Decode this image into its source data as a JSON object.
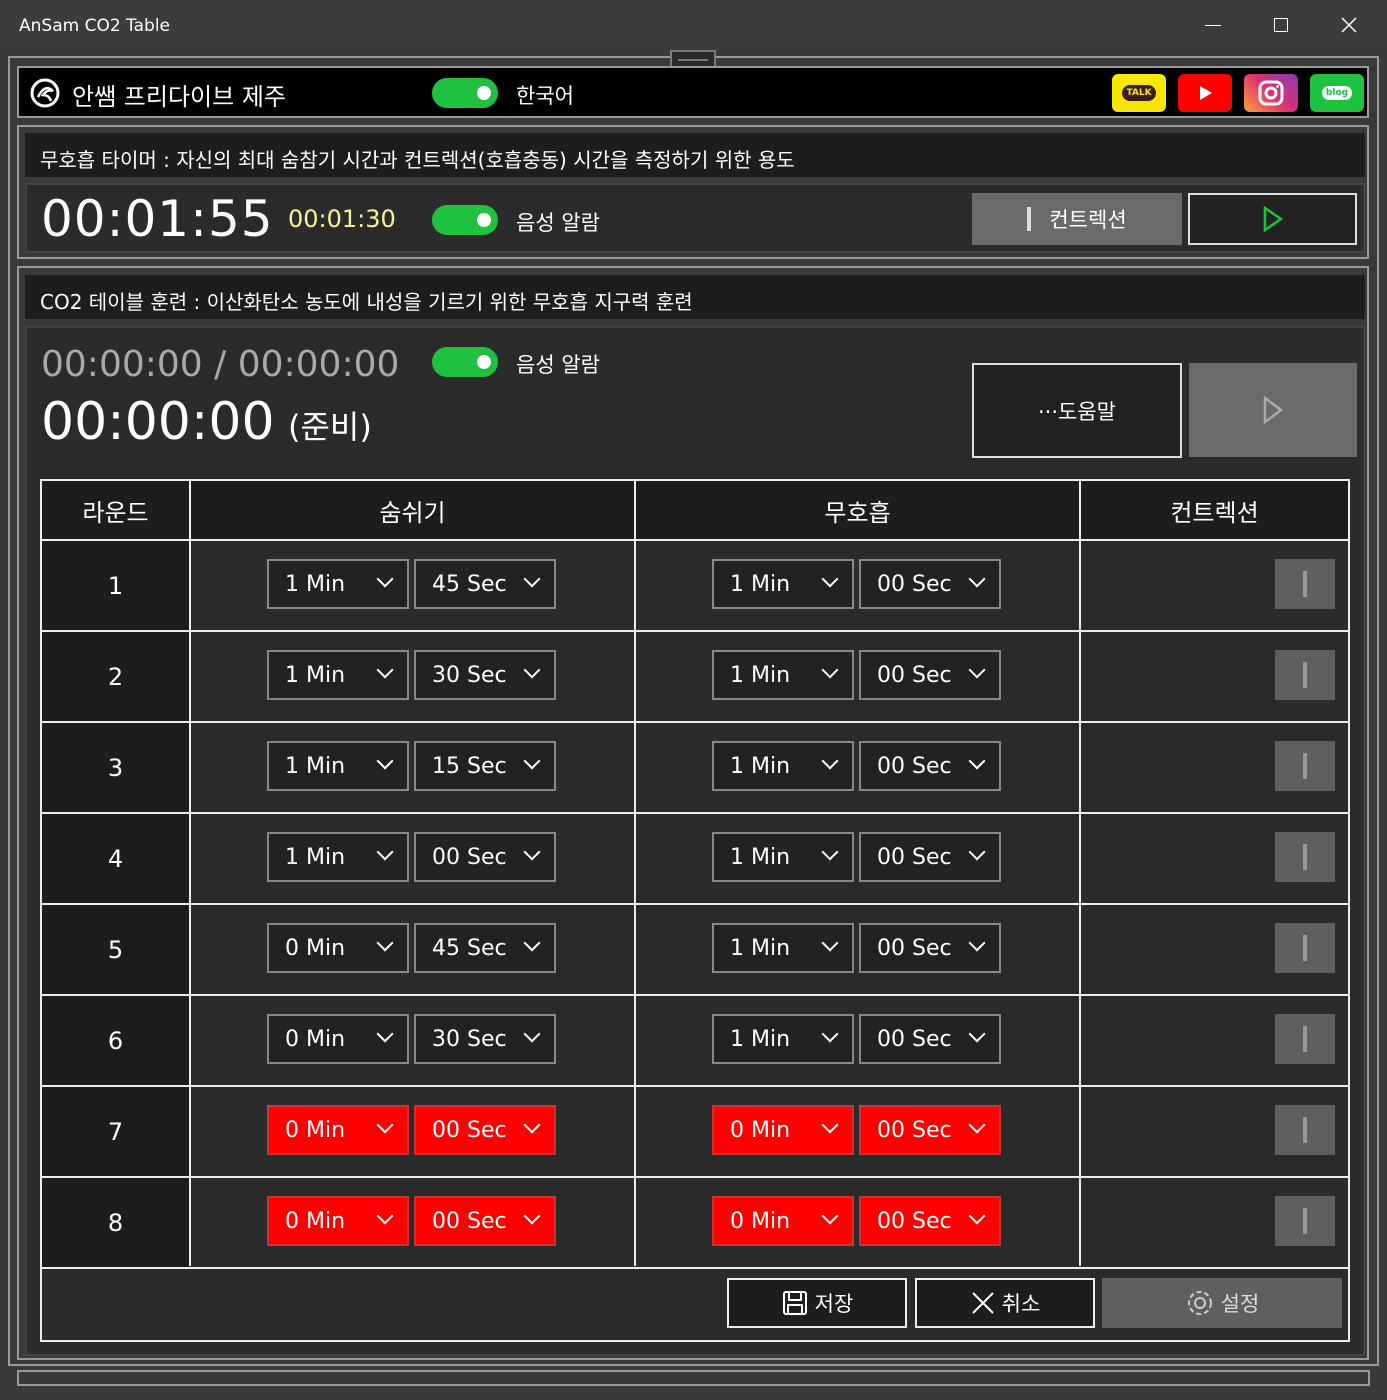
{
  "window": {
    "title": "AnSam CO2 Table"
  },
  "header": {
    "brand": "안쌤 프리다이브 제주",
    "language": "한국어",
    "language_toggle_on": true,
    "social": [
      "kakaotalk-icon",
      "youtube-icon",
      "instagram-icon",
      "blog-icon"
    ],
    "talk_label": "TALK",
    "blog_label": "blog"
  },
  "apnea_timer": {
    "title": "무호흡 타이머 : 자신의 최대 숨참기 시간과 컨트렉션(호흡충동) 시간을 측정하기 위한 용도",
    "elapsed": "00:01:55",
    "contraction_time": "00:01:30",
    "voice_label": "음성 알람",
    "voice_on": true,
    "contraction_button": "컨트렉션"
  },
  "co2_table": {
    "title": "CO2 테이블 훈련 : 이산화탄소 농도에 내성을 기르기 위한 무호흡 지구력 훈련",
    "progress": "00:00:00 / 00:00:00",
    "current_time": "00:00:00",
    "state": "(준비)",
    "voice_label": "음성 알람",
    "voice_on": true,
    "help_button": "···도움말",
    "headers": {
      "round": "라운드",
      "breathe": "숨쉬기",
      "hold": "무호흡",
      "contraction": "컨트렉션"
    },
    "rows": [
      {
        "round": "1",
        "breathe_min": "1 Min",
        "breathe_sec": "45 Sec",
        "hold_min": "1 Min",
        "hold_sec": "00 Sec",
        "invalid": false
      },
      {
        "round": "2",
        "breathe_min": "1 Min",
        "breathe_sec": "30 Sec",
        "hold_min": "1 Min",
        "hold_sec": "00 Sec",
        "invalid": false
      },
      {
        "round": "3",
        "breathe_min": "1 Min",
        "breathe_sec": "15 Sec",
        "hold_min": "1 Min",
        "hold_sec": "00 Sec",
        "invalid": false
      },
      {
        "round": "4",
        "breathe_min": "1 Min",
        "breathe_sec": "00 Sec",
        "hold_min": "1 Min",
        "hold_sec": "00 Sec",
        "invalid": false
      },
      {
        "round": "5",
        "breathe_min": "0 Min",
        "breathe_sec": "45 Sec",
        "hold_min": "1 Min",
        "hold_sec": "00 Sec",
        "invalid": false
      },
      {
        "round": "6",
        "breathe_min": "0 Min",
        "breathe_sec": "30 Sec",
        "hold_min": "1 Min",
        "hold_sec": "00 Sec",
        "invalid": false
      },
      {
        "round": "7",
        "breathe_min": "0 Min",
        "breathe_sec": "00 Sec",
        "hold_min": "0 Min",
        "hold_sec": "00 Sec",
        "invalid": true
      },
      {
        "round": "8",
        "breathe_min": "0 Min",
        "breathe_sec": "00 Sec",
        "hold_min": "0 Min",
        "hold_sec": "00 Sec",
        "invalid": true
      }
    ],
    "save_button": "저장",
    "cancel_button": "취소",
    "settings_button": "설정"
  },
  "colors": {
    "toggle_on": "#1ec23e",
    "play_icon": "#1ec23e",
    "invalid_combo": "#ff0000",
    "contraction_time": "#f4f49e"
  }
}
